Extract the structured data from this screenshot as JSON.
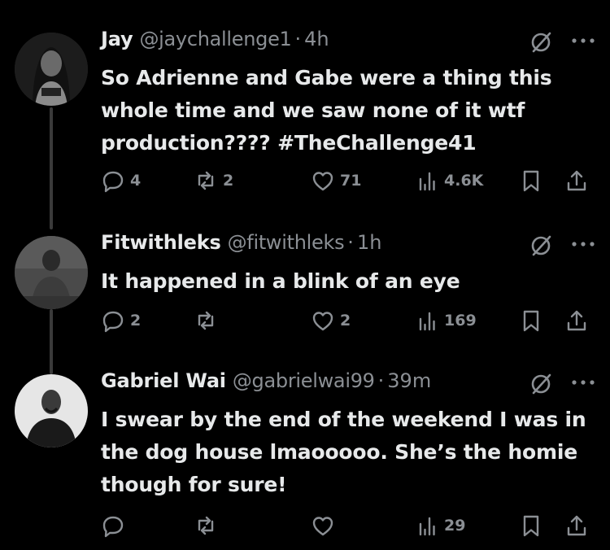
{
  "tweets": [
    {
      "name": "Jay",
      "handle": "@jaychallenge1",
      "separator": "·",
      "time": "4h",
      "text_parts": [
        "So Adrienne and Gabe were a thing this whole time and we saw none of it wtf production???? ",
        "#TheChallenge41"
      ],
      "replies": "4",
      "reposts": "2",
      "likes": "71",
      "views": "4.6K"
    },
    {
      "name": "Fitwithleks",
      "handle": "@fitwithleks",
      "separator": "·",
      "time": "1h",
      "text": "It happened in a blink of an eye",
      "replies": "2",
      "reposts": "",
      "likes": "2",
      "views": "169"
    },
    {
      "name": "Gabriel Wai",
      "handle": "@gabrielwai99",
      "separator": "·",
      "time": "39m",
      "text": "I swear by the end of the weekend I was in the dog house lmaooooo. She’s the homie though for sure!",
      "replies": "",
      "reposts": "",
      "likes": "",
      "views": "29"
    }
  ],
  "icons": [
    "reply-icon",
    "repost-icon",
    "like-icon",
    "views-icon",
    "bookmark-icon",
    "share-icon",
    "grok-icon",
    "more-icon"
  ],
  "colors": {
    "background": "#000000",
    "text": "#e7e9ea",
    "secondary": "#8b8f94"
  }
}
